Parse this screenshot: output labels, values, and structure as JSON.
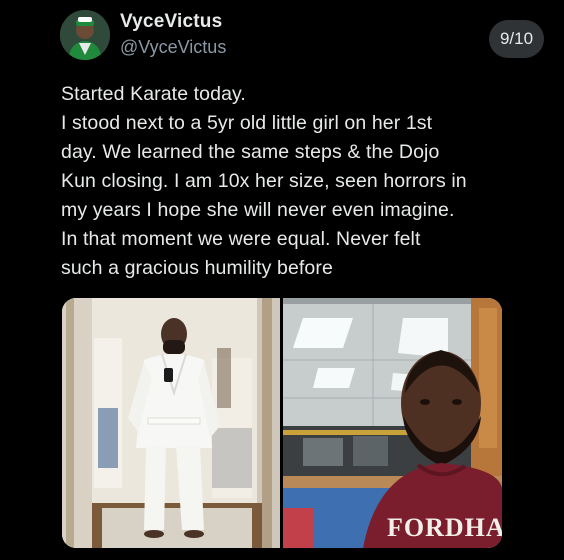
{
  "author": {
    "display_name": "VyceVictus",
    "handle": "@VyceVictus"
  },
  "thread_counter": "9/10",
  "tweet": {
    "lines": [
      "Started Karate today.",
      "I stood next to a 5yr old little girl on her 1st",
      "day. We learned the same steps & the Dojo",
      "Kun closing. I am 10x her size, seen horrors in",
      "my years I hope she will never even imagine.",
      "In that moment we were equal. Never felt",
      "such a gracious humility before"
    ]
  },
  "media": {
    "left_photo": {
      "icon": "mirror-selfie-karate-gi-photo"
    },
    "right_photo": {
      "icon": "selfie-in-dojo-photo",
      "shirt_text": "FORDHAM"
    }
  },
  "colors": {
    "background": "#000000",
    "text_primary": "#e7e9ea",
    "text_secondary": "#8b98a5",
    "counter_bg": "#2f3336",
    "shirt_maroon": "#7a1e2e"
  }
}
